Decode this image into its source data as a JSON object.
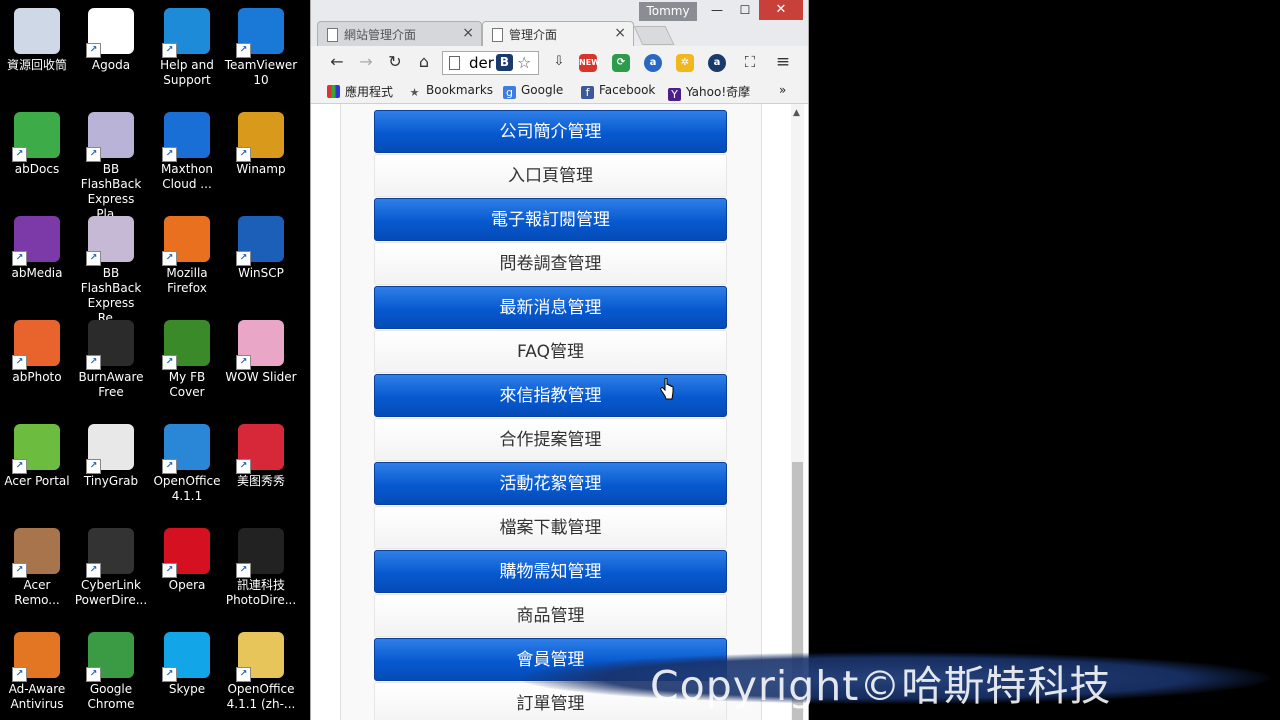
{
  "desktop": {
    "icons": [
      {
        "label": "資源回收筒",
        "icon": "recycle-bin-icon",
        "color": "#cfd8e6"
      },
      {
        "label": "Agoda",
        "icon": "agoda-icon",
        "color": "#ffffff"
      },
      {
        "label": "Help and Support",
        "icon": "help-icon",
        "color": "#1e8bd8"
      },
      {
        "label": "TeamViewer 10",
        "icon": "teamviewer-icon",
        "color": "#1a78d6"
      },
      {
        "label": "abDocs",
        "icon": "abdocs-icon",
        "color": "#3dab47"
      },
      {
        "label": "BB FlashBack Express Pla...",
        "icon": "flashback-player-icon",
        "color": "#b9b3d8"
      },
      {
        "label": "Maxthon Cloud ...",
        "icon": "maxthon-icon",
        "color": "#1a6fd6"
      },
      {
        "label": "Winamp",
        "icon": "winamp-icon",
        "color": "#d99a1c"
      },
      {
        "label": "abMedia",
        "icon": "abmedia-icon",
        "color": "#7b3aa8"
      },
      {
        "label": "BB FlashBack Express Re...",
        "icon": "flashback-recorder-icon",
        "color": "#c6b9d6"
      },
      {
        "label": "Mozilla Firefox",
        "icon": "firefox-icon",
        "color": "#e8701e"
      },
      {
        "label": "WinSCP",
        "icon": "winscp-icon",
        "color": "#1c5fb8"
      },
      {
        "label": "abPhoto",
        "icon": "abphoto-icon",
        "color": "#e9632d"
      },
      {
        "label": "BurnAware Free",
        "icon": "burnaware-icon",
        "color": "#2b2b2b"
      },
      {
        "label": "My FB Cover",
        "icon": "fb-cover-icon",
        "color": "#3a8a2a"
      },
      {
        "label": "WOW Slider",
        "icon": "wow-slider-icon",
        "color": "#e9a6c7"
      },
      {
        "label": "Acer Portal",
        "icon": "acer-portal-icon",
        "color": "#6cbd3f"
      },
      {
        "label": "TinyGrab",
        "icon": "tinygrab-icon",
        "color": "#e8e8e8"
      },
      {
        "label": "OpenOffice 4.1.1",
        "icon": "openoffice-icon",
        "color": "#2a86d6"
      },
      {
        "label": "美图秀秀",
        "icon": "meitu-icon",
        "color": "#d7283a"
      },
      {
        "label": "Acer Remo...",
        "icon": "acer-remote-icon",
        "color": "#a8744b"
      },
      {
        "label": "CyberLink PowerDire...",
        "icon": "powerdirector-icon",
        "color": "#333333"
      },
      {
        "label": "Opera",
        "icon": "opera-icon",
        "color": "#d51020"
      },
      {
        "label": "訊連科技 PhotoDire...",
        "icon": "photodirector-icon",
        "color": "#222222"
      },
      {
        "label": "Ad-Aware Antivirus",
        "icon": "adaware-icon",
        "color": "#e27622"
      },
      {
        "label": "Google Chrome",
        "icon": "chrome-icon",
        "color": "#3b9a44"
      },
      {
        "label": "Skype",
        "icon": "skype-icon",
        "color": "#12a5e8"
      },
      {
        "label": "OpenOffice 4.1.1 (zh-...",
        "icon": "folder-icon",
        "color": "#e8c55a"
      }
    ]
  },
  "browser": {
    "user": "Tommy",
    "tabs": [
      {
        "label": "網站管理介面",
        "active": false
      },
      {
        "label": "管理介面",
        "active": true
      }
    ],
    "window_controls": {
      "minimize": "—",
      "maximize": "☐",
      "close": "✕"
    },
    "address": "der",
    "bookmarks": [
      {
        "label": "應用程式",
        "icon": "apps-grid-icon"
      },
      {
        "label": "Bookmarks",
        "icon": "star-icon"
      },
      {
        "label": "Google",
        "icon": "google-icon"
      },
      {
        "label": "Facebook",
        "icon": "facebook-icon"
      },
      {
        "label": "Yahoo!奇摩",
        "icon": "yahoo-icon"
      }
    ],
    "bookmarks_overflow": "»"
  },
  "page": {
    "menu": [
      {
        "label": "公司簡介管理",
        "style": "primary"
      },
      {
        "label": "入口頁管理",
        "style": "secondary"
      },
      {
        "label": "電子報訂閱管理",
        "style": "primary"
      },
      {
        "label": "問卷調查管理",
        "style": "secondary"
      },
      {
        "label": "最新消息管理",
        "style": "primary"
      },
      {
        "label": "FAQ管理",
        "style": "secondary"
      },
      {
        "label": "來信指教管理",
        "style": "primary"
      },
      {
        "label": "合作提案管理",
        "style": "secondary"
      },
      {
        "label": "活動花絮管理",
        "style": "primary"
      },
      {
        "label": "檔案下載管理",
        "style": "secondary"
      },
      {
        "label": "購物需知管理",
        "style": "primary"
      },
      {
        "label": "商品管理",
        "style": "secondary"
      },
      {
        "label": "會員管理",
        "style": "primary"
      },
      {
        "label": "訂單管理",
        "style": "secondary"
      }
    ]
  },
  "watermark": {
    "text": "Copyright©哈斯特科技"
  },
  "colors": {
    "primary": "#0759cf",
    "close_button": "#c7413a"
  }
}
